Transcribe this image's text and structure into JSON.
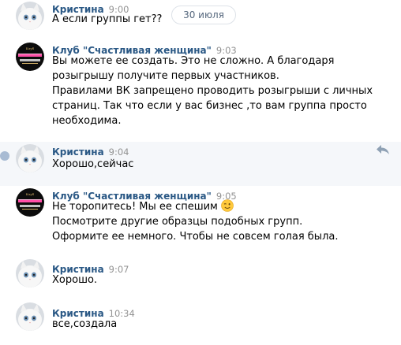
{
  "date_divider": "30 июля",
  "messages": [
    {
      "author": "Кристина",
      "time": "9:00",
      "avatar": "white-kitten",
      "lines": [
        "А если группы гет??"
      ]
    },
    {
      "author": "Клуб \"Счастливая женщина\"",
      "time": "9:03",
      "avatar": "club-logo",
      "lines": [
        "Вы можете ее создать. Это не сложно. А благодаря",
        "розыгрышу получите первых участников.",
        "Правилами ВК запрещено проводить розыгрыши с личных",
        "страниц. Так что если у вас бизнес ,то вам группа просто",
        "необходима."
      ]
    },
    {
      "author": "Кристина",
      "time": "9:04",
      "avatar": "white-kitten",
      "lines": [
        "Хорошо,сейчас"
      ]
    },
    {
      "author": "Клуб \"Счастливая женщина\"",
      "time": "9:05",
      "avatar": "club-logo",
      "lines": [
        "Не торопитесь! Мы ее спешим",
        "Посмотрите другие образцы подобных групп.",
        "Оформите ее немного. Чтобы не совсем голая была."
      ],
      "emoji": "wink-emoji"
    },
    {
      "author": "Кристина",
      "time": "9:07",
      "avatar": "white-kitten",
      "lines": [
        "Хорошо."
      ]
    },
    {
      "author": "Кристина",
      "time": "10:34",
      "avatar": "white-kitten",
      "lines": [
        "все,создала"
      ]
    }
  ],
  "colors": {
    "author": "#2a5885",
    "time": "#939393",
    "text": "#000000",
    "hover_background": "#f5f7fa"
  }
}
